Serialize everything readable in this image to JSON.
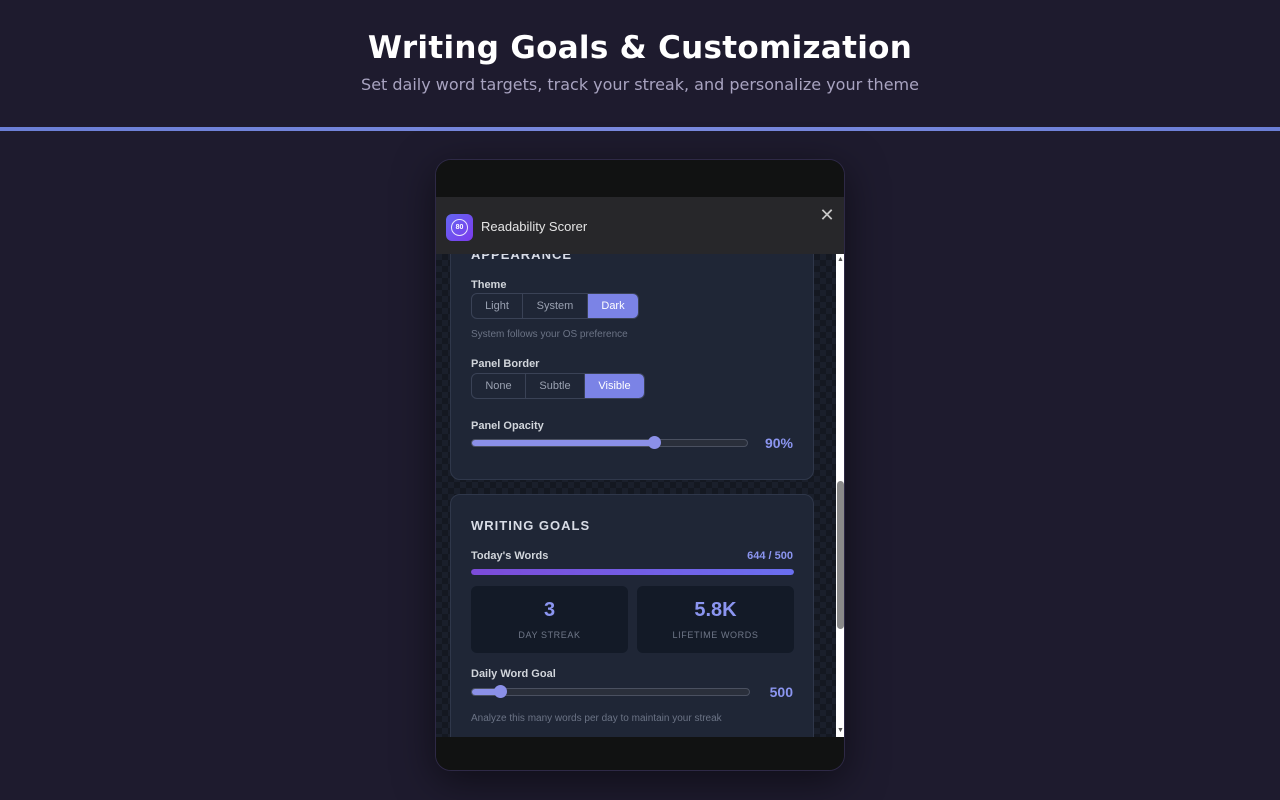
{
  "header": {
    "title": "Writing Goals & Customization",
    "subtitle": "Set daily word targets, track your streak, and personalize your theme"
  },
  "app": {
    "icon_text": "80",
    "name": "Readability Scorer"
  },
  "appearance": {
    "section_title": "APPEARANCE",
    "theme": {
      "label": "Theme",
      "options": [
        "Light",
        "System",
        "Dark"
      ],
      "selected": "Dark",
      "hint": "System follows your OS preference"
    },
    "panel_border": {
      "label": "Panel Border",
      "options": [
        "None",
        "Subtle",
        "Visible"
      ],
      "selected": "Visible"
    },
    "panel_opacity": {
      "label": "Panel Opacity",
      "value_text": "90%",
      "slider_fraction": 0.66
    }
  },
  "writing_goals": {
    "section_title": "WRITING GOALS",
    "todays_words": {
      "label": "Today's Words",
      "value_text": "644 / 500",
      "progress_fraction": 1.0
    },
    "stats": [
      {
        "value": "3",
        "label": "DAY STREAK"
      },
      {
        "value": "5.8K",
        "label": "LIFETIME WORDS"
      }
    ],
    "daily_goal": {
      "label": "Daily Word Goal",
      "value_text": "500",
      "slider_fraction": 0.1,
      "hint": "Analyze this many words per day to maintain your streak"
    }
  },
  "colors": {
    "accent": "#8b95f0",
    "active_segment": "#7b83e6",
    "page_background": "#1e1b2e"
  }
}
